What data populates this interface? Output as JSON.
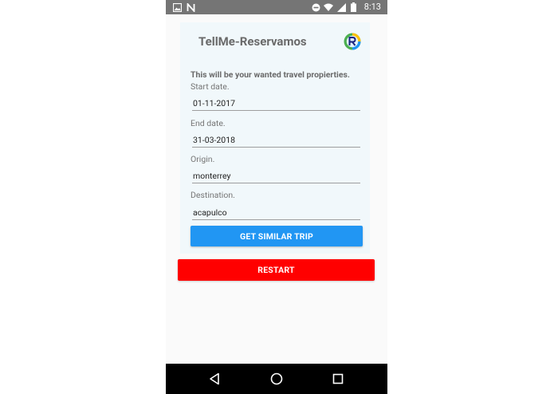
{
  "status_bar": {
    "time": "8:13",
    "icons_left": [
      "image-icon",
      "n-notification-icon"
    ],
    "icons_right": [
      "do-not-disturb-icon",
      "wifi-icon",
      "signal-icon",
      "battery-icon"
    ]
  },
  "header": {
    "title": "TellMe-Reservamos",
    "logo_icon": "reservamos-logo-icon"
  },
  "form": {
    "subtitle": "This will be your wanted travel propierties.",
    "fields": [
      {
        "label": "Start date.",
        "value": "01-11-2017"
      },
      {
        "label": "End date.",
        "value": "31-03-2018"
      },
      {
        "label": "Origin.",
        "value": "monterrey"
      },
      {
        "label": "Destination.",
        "value": "acapulco"
      }
    ]
  },
  "buttons": {
    "similar_trip": "GET SIMILAR TRIP",
    "restart": "RESTART"
  },
  "colors": {
    "primary_button": "#2196f3",
    "restart_button": "#ff0000",
    "status_bar": "#757575",
    "nav_bar": "#000000"
  },
  "nav_bar": {
    "icons": [
      "back-icon",
      "home-icon",
      "recents-icon"
    ]
  }
}
